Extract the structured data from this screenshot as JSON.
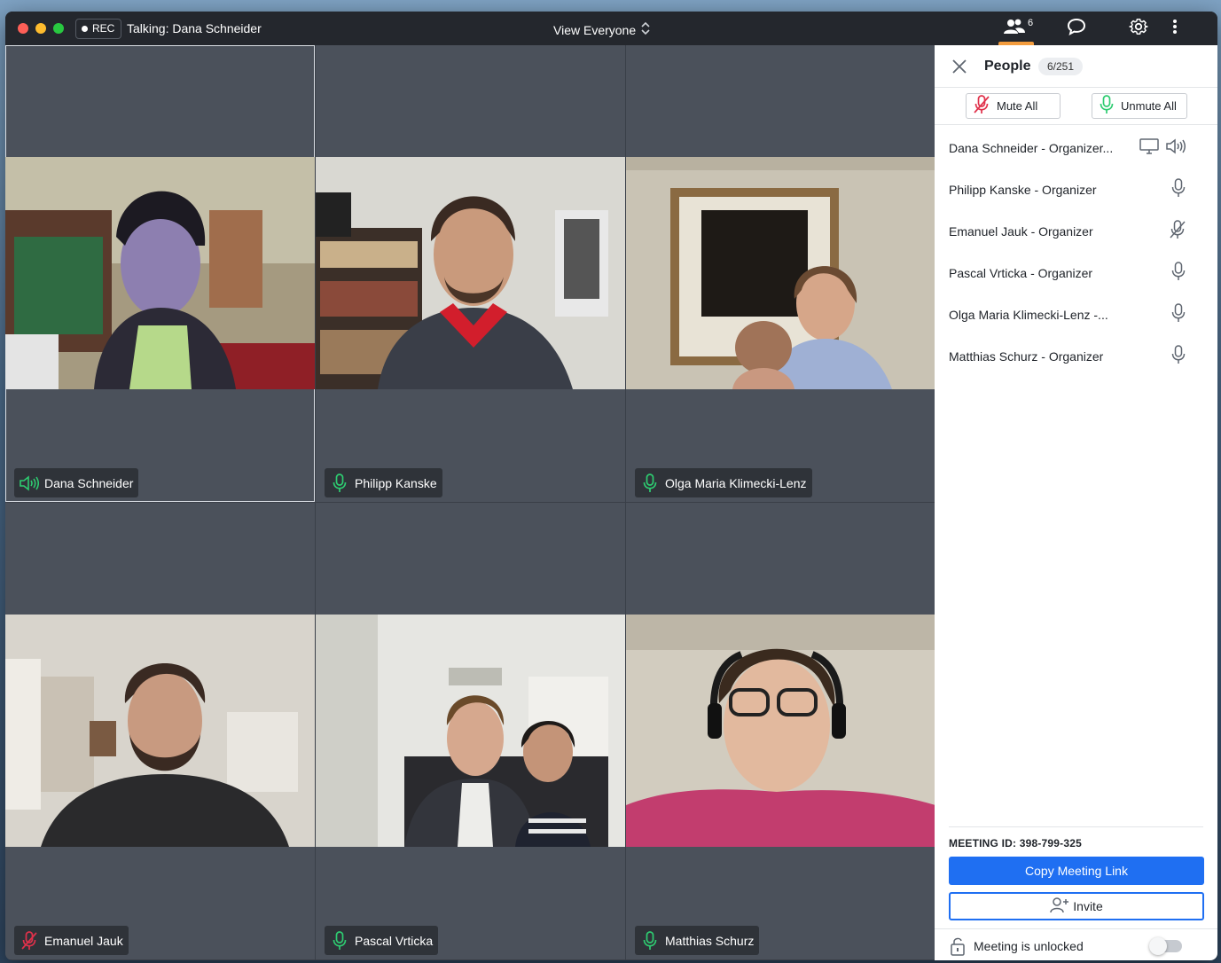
{
  "titlebar": {
    "rec_label": "REC",
    "talking": "Talking: Dana Schneider",
    "view_label": "View Everyone",
    "people_count": "6"
  },
  "tiles": [
    {
      "name": "Dana Schneider",
      "status": "speaking"
    },
    {
      "name": "Philipp Kanske",
      "status": "mic-on"
    },
    {
      "name": "Olga Maria Klimecki-Lenz",
      "status": "mic-on"
    },
    {
      "name": "Emanuel Jauk",
      "status": "muted"
    },
    {
      "name": "Pascal Vrticka",
      "status": "mic-on"
    },
    {
      "name": "Matthias Schurz",
      "status": "mic-on"
    }
  ],
  "panel": {
    "title": "People",
    "badge": "6/251",
    "mute_all": "Mute All",
    "unmute_all": "Unmute All",
    "participants": [
      {
        "label": "Dana Schneider - Organizer...",
        "icons": [
          "screen-share-icon",
          "speaker-icon"
        ]
      },
      {
        "label": "Philipp Kanske - Organizer",
        "icons": [
          "microphone-icon"
        ]
      },
      {
        "label": "Emanuel Jauk - Organizer",
        "icons": [
          "microphone-muted-icon"
        ]
      },
      {
        "label": "Pascal Vrticka - Organizer",
        "icons": [
          "microphone-icon"
        ]
      },
      {
        "label": "Olga Maria Klimecki-Lenz -...",
        "icons": [
          "microphone-icon"
        ]
      },
      {
        "label": "Matthias Schurz - Organizer",
        "icons": [
          "microphone-icon"
        ]
      }
    ],
    "meeting_id": "MEETING ID: 398-799-325",
    "copy_link": "Copy Meeting Link",
    "invite": "Invite",
    "lock_text": "Meeting is unlocked",
    "lock_toggle_on": false
  },
  "colors": {
    "accent_blue": "#1f6ff2",
    "mic_green": "#2ecc71",
    "mute_red": "#e0314b",
    "people_underline": "#f39c3d"
  }
}
